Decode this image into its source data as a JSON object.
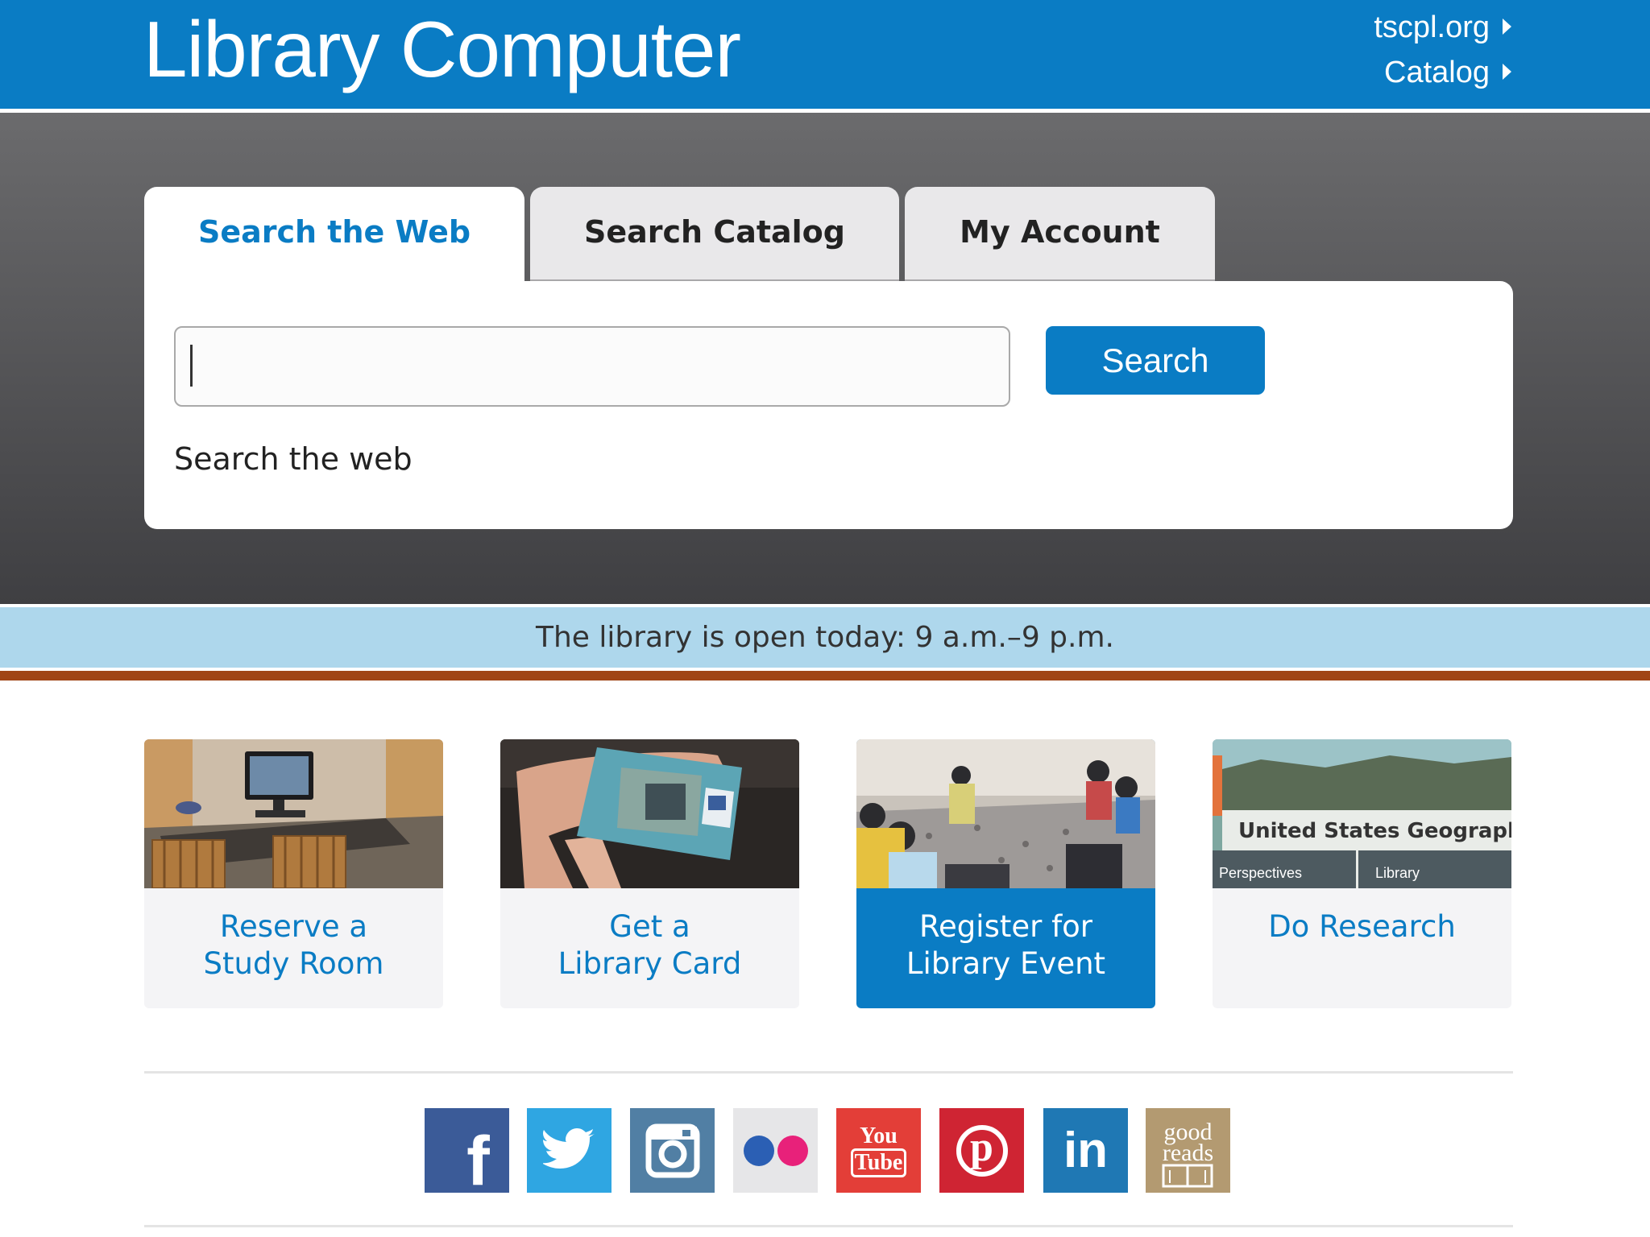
{
  "header": {
    "title": "Library Computer",
    "links": [
      {
        "label": "tscpl.org"
      },
      {
        "label": "Catalog"
      }
    ],
    "background_color": "#0a7cc4"
  },
  "search": {
    "tabs": [
      {
        "label": "Search the Web",
        "active": true
      },
      {
        "label": "Search Catalog",
        "active": false
      },
      {
        "label": "My Account",
        "active": false
      }
    ],
    "input_value": "",
    "button_label": "Search",
    "hint": "Search the web"
  },
  "hours": {
    "text": "The library is open today: 9 a.m.–9 p.m."
  },
  "cards": [
    {
      "label_line1": "Reserve a",
      "label_line2": "Study Room",
      "icon": "study-room-photo"
    },
    {
      "label_line1": "Get a",
      "label_line2": "Library Card",
      "icon": "library-card-photo"
    },
    {
      "label_line1": "Register for",
      "label_line2": "Library Event",
      "icon": "library-event-photo",
      "highlighted": true
    },
    {
      "label_line1": "Do Research",
      "label_line2": "",
      "icon": "research-database-photo",
      "image_text": {
        "title": "United States Geography",
        "tab1": "Perspectives",
        "tab2": "Library"
      }
    }
  ],
  "social": [
    {
      "name": "facebook",
      "glyph": "f",
      "color": "#3b5b98"
    },
    {
      "name": "twitter",
      "color": "#2fa6e2"
    },
    {
      "name": "instagram",
      "color": "#517fa4"
    },
    {
      "name": "flickr",
      "color": "#e6e6e8"
    },
    {
      "name": "youtube",
      "glyph_top": "You",
      "glyph_bottom": "Tube",
      "color": "#e33e38"
    },
    {
      "name": "pinterest",
      "glyph": "p",
      "color": "#cf2433"
    },
    {
      "name": "linkedin",
      "glyph": "in",
      "color": "#1f78b4"
    },
    {
      "name": "goodreads",
      "glyph_top": "good",
      "glyph_bottom": "reads",
      "color": "#b39a71"
    }
  ],
  "colors": {
    "accent": "#0a7cc4",
    "hours_bar": "#aed7ec",
    "rule": "#a04516"
  }
}
